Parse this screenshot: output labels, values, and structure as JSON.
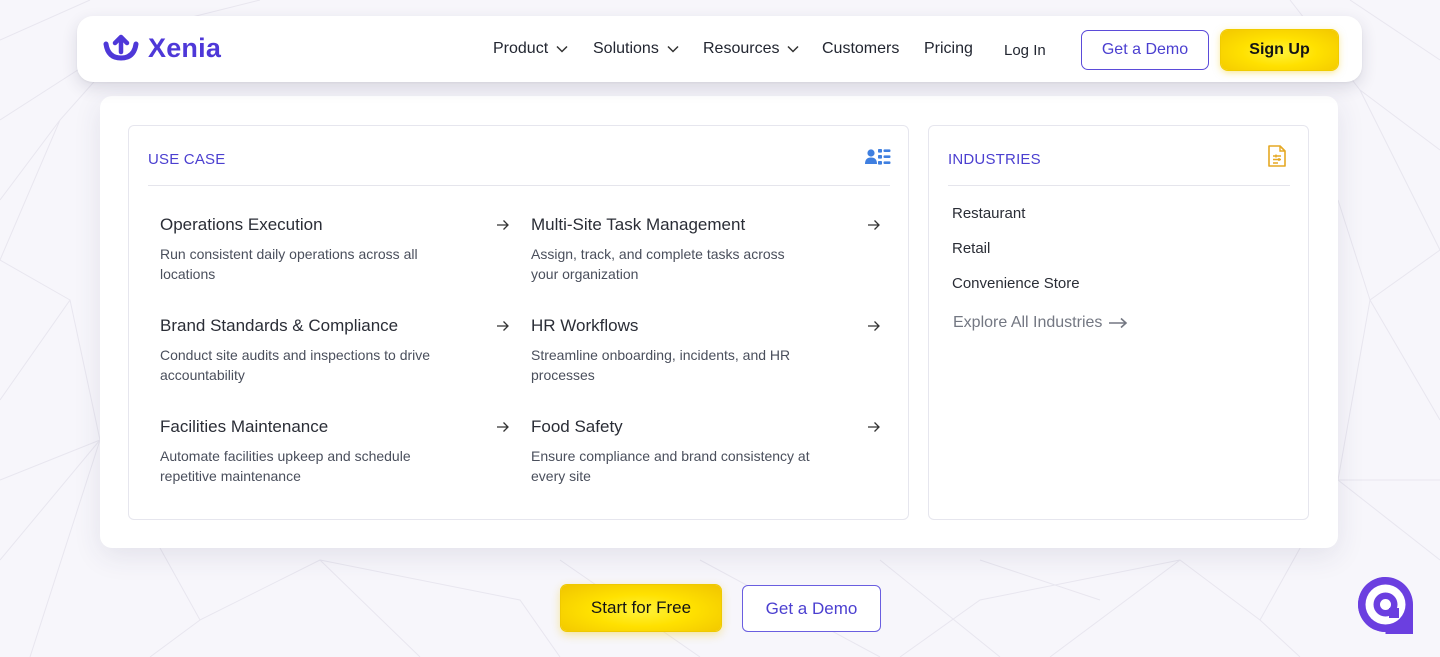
{
  "brand": {
    "name": "Xenia",
    "color": "#4e38d8"
  },
  "nav": {
    "items": [
      {
        "label": "Product",
        "has_dropdown": true
      },
      {
        "label": "Solutions",
        "has_dropdown": true
      },
      {
        "label": "Resources",
        "has_dropdown": true
      },
      {
        "label": "Customers",
        "has_dropdown": false
      },
      {
        "label": "Pricing",
        "has_dropdown": false
      }
    ],
    "login_label": "Log In",
    "demo_label": "Get a Demo",
    "signup_label": "Sign Up"
  },
  "dropdown": {
    "use_case": {
      "heading": "USE CASE",
      "icon": "users-list-icon",
      "items": [
        {
          "title": "Operations Execution",
          "desc": "Run consistent daily operations across all locations"
        },
        {
          "title": "Multi-Site Task Management",
          "desc": "Assign, track, and complete tasks across your organization"
        },
        {
          "title": "Brand Standards & Compliance",
          "desc": "Conduct site audits and inspections to drive accountability"
        },
        {
          "title": "HR Workflows",
          "desc": "Streamline onboarding, incidents, and HR processes"
        },
        {
          "title": "Facilities Maintenance",
          "desc": "Automate facilities upkeep and schedule repetitive maintenance"
        },
        {
          "title": "Food Safety",
          "desc": "Ensure compliance and brand consistency at every site"
        }
      ]
    },
    "industries": {
      "heading": "INDUSTRIES",
      "icon": "document-list-icon",
      "items": [
        "Restaurant",
        "Retail",
        "Convenience Store"
      ],
      "explore_label": "Explore All Industries"
    }
  },
  "cta": {
    "start_label": "Start for Free",
    "demo_label": "Get a Demo"
  },
  "colors": {
    "accent": "#4b3fd0",
    "yellow": "#ffe100",
    "industries_icon": "#e5a823",
    "usecase_icon": "#3f7fe0"
  }
}
